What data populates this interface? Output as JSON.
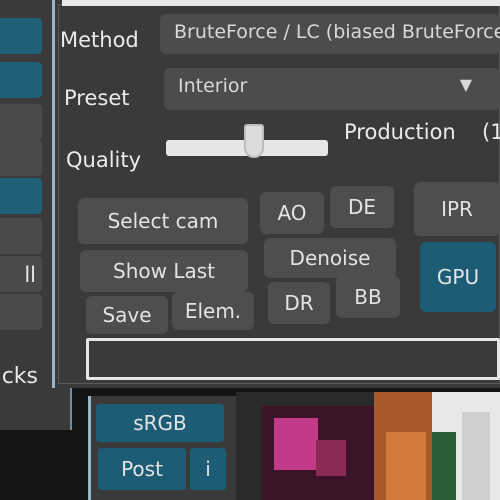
{
  "left_panel": {
    "items": [
      {
        "label": "",
        "active": true
      },
      {
        "label": "",
        "active": false
      },
      {
        "label": "",
        "active": false
      },
      {
        "label": "",
        "active": true
      },
      {
        "label": "",
        "active": false
      },
      {
        "label": "ll",
        "active": false
      },
      {
        "label": "",
        "active": false
      },
      {
        "label": "cks",
        "active": false
      }
    ]
  },
  "render": {
    "method_label": "Method",
    "method_value": "BruteForce / LC (biased BruteForce)",
    "preset_label": "Preset",
    "preset_value": "Interior",
    "quality_label": "Quality",
    "quality_value": "Production",
    "quality_suffix": "(1",
    "quality_level": 0.55
  },
  "buttons": {
    "select_cam": "Select cam",
    "show_last": "Show Last",
    "save": "Save",
    "elem": "Elem.",
    "ao": "AO",
    "de": "DE",
    "denoise": "Denoise",
    "dr": "DR",
    "bb": "BB",
    "ipr": "IPR",
    "gpu": "GPU"
  },
  "bottom": {
    "srgb": "sRGB",
    "post": "Post",
    "info": "i"
  },
  "colors": {
    "panel_bg": "#3a3a3a",
    "button_bg": "#4e4e4e",
    "accent_blue": "#1d5c75",
    "border_light": "#9ab5c6"
  }
}
